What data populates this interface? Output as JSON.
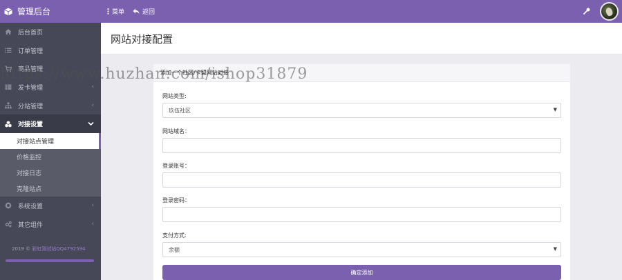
{
  "topbar": {
    "brand": "管理后台",
    "menu_label": "菜单",
    "back_label": "返回"
  },
  "sidebar": {
    "items": [
      {
        "label": "后台首页",
        "icon": "home-icon"
      },
      {
        "label": "订单管理",
        "icon": "list-icon"
      },
      {
        "label": "商品管理",
        "icon": "cart-icon"
      },
      {
        "label": "发卡管理",
        "icon": "grid-icon"
      },
      {
        "label": "分站管理",
        "icon": "sitemap-icon"
      },
      {
        "label": "对接设置",
        "icon": "cubes-icon"
      }
    ],
    "submenu": [
      "对接站点管理",
      "价格监控",
      "对接日志",
      "克隆站点"
    ],
    "items_after": [
      {
        "label": "系统设置",
        "icon": "gear-icon"
      },
      {
        "label": "其它组件",
        "icon": "gears-icon"
      }
    ],
    "footer_year": "2019 ©",
    "footer_link": "彩虹测试站QQ4792594"
  },
  "page": {
    "title": "网站对接配置"
  },
  "panel": {
    "heading": "添加一个社区/卡盟网站对接",
    "site_type_label": "网站类型:",
    "site_type_value": "玖伍社区",
    "domain_label": "网站域名：",
    "domain_value": "",
    "account_label": "登录账号：",
    "account_value": "",
    "password_label": "登录密码：",
    "password_value": "",
    "payment_label": "支付方式:",
    "payment_value": "余额",
    "submit_label": "确定添加"
  },
  "watermark": "https://www.huzhan.com/ishop31879",
  "colors": {
    "accent": "#7b60b0",
    "sidebar": "#474857",
    "background": "#ecebf0"
  }
}
